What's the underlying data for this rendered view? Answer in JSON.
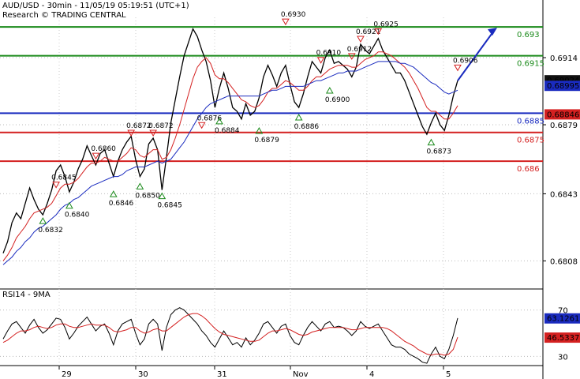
{
  "header": {
    "title": "AUD/USD - 30min - 11/05/19 05:19:51 (UTC+1)",
    "subtitle": "Research © TRADING CENTRAL"
  },
  "rsi_panel": {
    "label": "RSI14 - 9MA"
  },
  "chart_data": [
    {
      "type": "line",
      "name": "AUD/USD price",
      "x_ticks": [
        "29",
        "30",
        "31",
        "Nov",
        "4",
        "5"
      ],
      "y_ticks": [
        0.6808,
        0.6843,
        0.6879,
        0.6914
      ],
      "ylim": [
        0.6795,
        0.6935
      ],
      "levels": [
        {
          "value": 0.693,
          "label": "0.693",
          "color": "#1a8a1a"
        },
        {
          "value": 0.6915,
          "label": "0.6915",
          "color": "#1a8a1a"
        },
        {
          "value": 0.6885,
          "label": "0.6885",
          "color": "#1a2bbf"
        },
        {
          "value": 0.6875,
          "label": "0.6875",
          "color": "#d42020"
        },
        {
          "value": 0.686,
          "label": "0.686",
          "color": "#d42020"
        }
      ],
      "price_tags": [
        {
          "value": 0.69024,
          "label": "0.69024",
          "bg": "#111111",
          "fg": "#ffffff"
        },
        {
          "value": 0.68995,
          "label": "0.68995",
          "bg": "#1a2bbf",
          "fg": "#ffffff"
        },
        {
          "value": 0.68846,
          "label": "0.68846",
          "bg": "#d42020",
          "fg": "#ffffff"
        }
      ],
      "highs": [
        {
          "label": "0.6845",
          "value": 0.6845
        },
        {
          "label": "0.6860",
          "value": 0.686
        },
        {
          "label": "0.6872",
          "value": 0.6872
        },
        {
          "label": "0.6872",
          "value": 0.6872
        },
        {
          "label": "0.6876",
          "value": 0.6876
        },
        {
          "label": "0.6930",
          "value": 0.693
        },
        {
          "label": "0.6910",
          "value": 0.691
        },
        {
          "label": "0.6912",
          "value": 0.6912
        },
        {
          "label": "0.6921",
          "value": 0.6921
        },
        {
          "label": "0.6925",
          "value": 0.6925
        },
        {
          "label": "0.6906",
          "value": 0.6906
        }
      ],
      "lows": [
        {
          "label": "0.6832",
          "value": 0.6832
        },
        {
          "label": "0.6840",
          "value": 0.684
        },
        {
          "label": "0.6846",
          "value": 0.6846
        },
        {
          "label": "0.6850",
          "value": 0.685
        },
        {
          "label": "0.6845",
          "value": 0.6845
        },
        {
          "label": "0.6884",
          "value": 0.6884
        },
        {
          "label": "0.6879",
          "value": 0.6879
        },
        {
          "label": "0.6886",
          "value": 0.6886
        },
        {
          "label": "0.6900",
          "value": 0.69
        },
        {
          "label": "0.6873",
          "value": 0.6873
        }
      ],
      "series": [
        {
          "color": "#000000",
          "values": [
            0.6812,
            0.6818,
            0.6828,
            0.6833,
            0.683,
            0.6838,
            0.6846,
            0.684,
            0.6835,
            0.6832,
            0.6838,
            0.6845,
            0.6855,
            0.6858,
            0.6852,
            0.6844,
            0.6849,
            0.6856,
            0.6861,
            0.6868,
            0.6863,
            0.6858,
            0.6864,
            0.6866,
            0.6859,
            0.6852,
            0.686,
            0.6866,
            0.687,
            0.6873,
            0.6861,
            0.6852,
            0.6856,
            0.6869,
            0.6872,
            0.6866,
            0.6845,
            0.6862,
            0.688,
            0.6892,
            0.6904,
            0.6915,
            0.6922,
            0.6929,
            0.6925,
            0.6918,
            0.6912,
            0.6902,
            0.6888,
            0.6898,
            0.6906,
            0.6898,
            0.6888,
            0.6886,
            0.6882,
            0.689,
            0.6884,
            0.6886,
            0.6893,
            0.6904,
            0.691,
            0.6905,
            0.6899,
            0.6906,
            0.691,
            0.69,
            0.6891,
            0.6888,
            0.6895,
            0.6904,
            0.6912,
            0.6909,
            0.6906,
            0.6914,
            0.6918,
            0.6911,
            0.6912,
            0.691,
            0.6908,
            0.6904,
            0.6909,
            0.6921,
            0.6918,
            0.6916,
            0.692,
            0.6924,
            0.6918,
            0.6914,
            0.691,
            0.6906,
            0.6906,
            0.6902,
            0.6896,
            0.689,
            0.6884,
            0.6878,
            0.6874,
            0.688,
            0.6885,
            0.6879,
            0.6876,
            0.6884,
            0.6894,
            0.6902
          ]
        },
        {
          "color": "#d42020",
          "values": [
            0.6808,
            0.6811,
            0.6815,
            0.682,
            0.6823,
            0.6826,
            0.683,
            0.6833,
            0.6834,
            0.6835,
            0.6836,
            0.6838,
            0.6842,
            0.6846,
            0.6848,
            0.6848,
            0.6849,
            0.6851,
            0.6854,
            0.6857,
            0.6859,
            0.6859,
            0.686,
            0.6862,
            0.6861,
            0.686,
            0.686,
            0.6862,
            0.6864,
            0.6867,
            0.6866,
            0.6863,
            0.6862,
            0.6864,
            0.6866,
            0.6866,
            0.6861,
            0.6862,
            0.6866,
            0.6872,
            0.6879,
            0.6887,
            0.6895,
            0.6903,
            0.6909,
            0.6912,
            0.6914,
            0.6911,
            0.6905,
            0.6903,
            0.6903,
            0.6901,
            0.6898,
            0.6895,
            0.6892,
            0.6891,
            0.6889,
            0.6888,
            0.6889,
            0.6892,
            0.6896,
            0.6898,
            0.6898,
            0.69,
            0.6902,
            0.6901,
            0.6899,
            0.6897,
            0.6897,
            0.6899,
            0.6902,
            0.6904,
            0.6904,
            0.6906,
            0.6908,
            0.6909,
            0.691,
            0.691,
            0.691,
            0.6909,
            0.6909,
            0.6911,
            0.6913,
            0.6914,
            0.6915,
            0.6917,
            0.6917,
            0.6916,
            0.6915,
            0.6913,
            0.6911,
            0.6909,
            0.6906,
            0.6902,
            0.6898,
            0.6893,
            0.6888,
            0.6886,
            0.6886,
            0.6884,
            0.6882,
            0.6882,
            0.6885,
            0.6889
          ]
        },
        {
          "color": "#1a2bbf",
          "values": [
            0.6806,
            0.6808,
            0.681,
            0.6813,
            0.6815,
            0.6818,
            0.682,
            0.6823,
            0.6825,
            0.6826,
            0.6828,
            0.683,
            0.6832,
            0.6835,
            0.6837,
            0.6838,
            0.684,
            0.6841,
            0.6843,
            0.6845,
            0.6847,
            0.6848,
            0.6849,
            0.685,
            0.6851,
            0.6852,
            0.6852,
            0.6853,
            0.6855,
            0.6856,
            0.6857,
            0.6857,
            0.6857,
            0.6858,
            0.6859,
            0.686,
            0.6859,
            0.686,
            0.6861,
            0.6864,
            0.6867,
            0.687,
            0.6874,
            0.6878,
            0.6882,
            0.6885,
            0.6888,
            0.689,
            0.6891,
            0.6892,
            0.6893,
            0.6894,
            0.6894,
            0.6894,
            0.6894,
            0.6894,
            0.6894,
            0.6894,
            0.6894,
            0.6895,
            0.6896,
            0.6897,
            0.6897,
            0.6898,
            0.6899,
            0.6899,
            0.6899,
            0.6899,
            0.6899,
            0.69,
            0.6901,
            0.6902,
            0.6902,
            0.6903,
            0.6904,
            0.6905,
            0.6906,
            0.6906,
            0.6907,
            0.6907,
            0.6907,
            0.6908,
            0.6909,
            0.691,
            0.6911,
            0.6912,
            0.6912,
            0.6912,
            0.6912,
            0.6912,
            0.6911,
            0.6911,
            0.691,
            0.6909,
            0.6907,
            0.6905,
            0.6903,
            0.6901,
            0.69,
            0.6898,
            0.6896,
            0.6895,
            0.6896,
            0.6897
          ]
        }
      ]
    },
    {
      "type": "line",
      "name": "RSI14 - 9MA",
      "ylim": [
        20,
        80
      ],
      "y_ticks": [
        30,
        70
      ],
      "tags": [
        {
          "value": 63.1261,
          "label": "63.1261",
          "bg": "#1a2bbf",
          "fg": "#ffffff"
        },
        {
          "value": 46.5337,
          "label": "46.5337",
          "bg": "#d42020",
          "fg": "#ffffff"
        }
      ],
      "series": [
        {
          "color": "#000000",
          "values": [
            45,
            52,
            58,
            60,
            55,
            50,
            57,
            62,
            55,
            50,
            53,
            58,
            63,
            62,
            55,
            45,
            50,
            56,
            60,
            64,
            58,
            52,
            56,
            58,
            50,
            40,
            52,
            58,
            60,
            62,
            50,
            40,
            45,
            58,
            62,
            58,
            35,
            55,
            66,
            70,
            72,
            70,
            66,
            62,
            58,
            52,
            48,
            42,
            38,
            45,
            52,
            46,
            40,
            42,
            38,
            46,
            40,
            44,
            50,
            58,
            60,
            55,
            50,
            56,
            58,
            48,
            42,
            40,
            48,
            55,
            60,
            56,
            52,
            58,
            60,
            55,
            56,
            55,
            52,
            48,
            52,
            60,
            56,
            54,
            56,
            58,
            52,
            46,
            40,
            38,
            38,
            36,
            32,
            30,
            28,
            25,
            24,
            32,
            38,
            30,
            28,
            36,
            48,
            63
          ]
        },
        {
          "color": "#d42020",
          "values": [
            42,
            44,
            47,
            50,
            52,
            52,
            53,
            55,
            56,
            55,
            54,
            55,
            57,
            58,
            58,
            56,
            55,
            55,
            56,
            57,
            58,
            57,
            57,
            57,
            55,
            52,
            51,
            52,
            53,
            55,
            55,
            52,
            50,
            51,
            53,
            54,
            52,
            52,
            55,
            58,
            61,
            64,
            66,
            67,
            67,
            65,
            62,
            58,
            54,
            51,
            49,
            48,
            47,
            46,
            45,
            44,
            43,
            43,
            44,
            47,
            50,
            52,
            52,
            53,
            54,
            53,
            51,
            49,
            48,
            49,
            51,
            52,
            53,
            54,
            55,
            55,
            55,
            55,
            54,
            53,
            53,
            54,
            55,
            55,
            55,
            55,
            55,
            54,
            52,
            49,
            46,
            43,
            41,
            39,
            36,
            34,
            32,
            31,
            32,
            32,
            31,
            32,
            36,
            46.5
          ]
        }
      ]
    }
  ]
}
